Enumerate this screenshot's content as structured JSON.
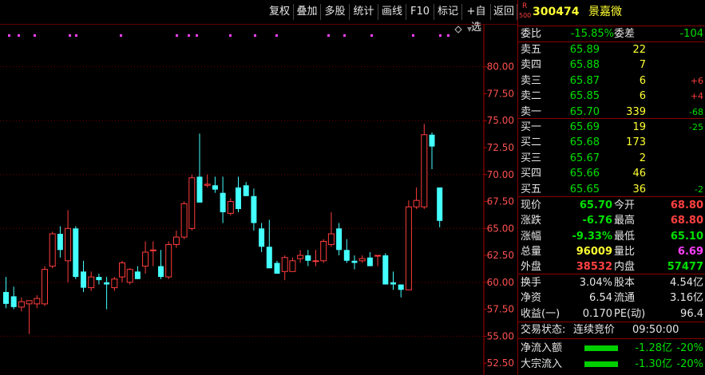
{
  "toolbar": {
    "buttons": [
      "复权",
      "叠加",
      "多股",
      "统计",
      "画线",
      "F10",
      "标记",
      "+自选",
      "返回"
    ]
  },
  "stock": {
    "badge_top": "R",
    "badge_bottom": "500",
    "code": "300474",
    "name": "景嘉微"
  },
  "weibi": {
    "label": "委比",
    "value": "-15.85%",
    "diff_label": "委差",
    "diff_value": "-104"
  },
  "sell": [
    {
      "label": "卖五",
      "price": "65.89",
      "vol": "22",
      "chg": ""
    },
    {
      "label": "卖四",
      "price": "65.88",
      "vol": "7",
      "chg": ""
    },
    {
      "label": "卖三",
      "price": "65.87",
      "vol": "6",
      "chg": "+6"
    },
    {
      "label": "卖二",
      "price": "65.85",
      "vol": "6",
      "chg": "+4"
    },
    {
      "label": "卖一",
      "price": "65.70",
      "vol": "339",
      "chg": "-68"
    }
  ],
  "buy": [
    {
      "label": "买一",
      "price": "65.69",
      "vol": "19",
      "chg": "-25"
    },
    {
      "label": "买二",
      "price": "65.68",
      "vol": "173",
      "chg": ""
    },
    {
      "label": "买三",
      "price": "65.67",
      "vol": "2",
      "chg": ""
    },
    {
      "label": "买四",
      "price": "65.66",
      "vol": "46",
      "chg": ""
    },
    {
      "label": "买五",
      "price": "65.65",
      "vol": "36",
      "chg": "-2"
    }
  ],
  "quote": [
    {
      "l1": "现价",
      "v1": "65.70",
      "c1": "dn",
      "l2": "今开",
      "v2": "68.80",
      "c2": "up"
    },
    {
      "l1": "涨跌",
      "v1": "-6.76",
      "c1": "dn",
      "l2": "最高",
      "v2": "68.80",
      "c2": "up"
    },
    {
      "l1": "涨幅",
      "v1": "-9.33%",
      "c1": "dn",
      "l2": "最低",
      "v2": "65.10",
      "c2": "dn"
    },
    {
      "l1": "总量",
      "v1": "96009",
      "c1": "yl",
      "l2": "量比",
      "v2": "6.69",
      "c2": "mg"
    },
    {
      "l1": "外盘",
      "v1": "38532",
      "c1": "up",
      "l2": "内盘",
      "v2": "57477",
      "c2": "dn"
    }
  ],
  "stats": [
    {
      "l1": "换手",
      "v1": "3.04%",
      "l2": "股本",
      "v2": "4.54亿"
    },
    {
      "l1": "净资",
      "v1": "6.54",
      "l2": "流通",
      "v2": "3.16亿"
    },
    {
      "l1": "收益(一)",
      "v1": "0.170",
      "l2": "PE(动)",
      "v2": "96.4"
    }
  ],
  "status": {
    "label": "交易状态:",
    "value": "连续竞价",
    "time": "09:50:00"
  },
  "flows": [
    {
      "label": "净流入额",
      "value": "-1.28亿",
      "pct": "-20%",
      "fill": 0.42
    },
    {
      "label": "大宗流入",
      "value": "-1.30亿",
      "pct": "-20%",
      "fill": 0.42
    }
  ],
  "chart_data": {
    "type": "candlestick",
    "y_ticks": [
      "80.00",
      "77.50",
      "75.00",
      "72.50",
      "70.00",
      "67.50",
      "65.00",
      "62.50",
      "60.00",
      "57.50",
      "55.00",
      "52.50"
    ],
    "ylim": [
      51.4,
      83.9
    ],
    "colors": {
      "up": "#ff3c3c",
      "down": "#44ffff",
      "grid": "#7a0000",
      "axis": "#b00000"
    },
    "candles": [
      [
        59.1,
        60.5,
        57.6,
        58.0
      ],
      [
        58.7,
        59.6,
        57.5,
        57.7
      ],
      [
        57.7,
        58.6,
        57.3,
        58.2
      ],
      [
        58.0,
        58.3,
        55.2,
        58.3
      ],
      [
        58.0,
        58.8,
        57.6,
        58.5
      ],
      [
        58.0,
        61.5,
        57.8,
        61.2
      ],
      [
        61.5,
        64.7,
        61.3,
        64.5
      ],
      [
        64.5,
        65.2,
        62.3,
        63.0
      ],
      [
        62.0,
        66.7,
        60.0,
        65.0
      ],
      [
        65.0,
        65.2,
        60.3,
        60.5
      ],
      [
        61.0,
        62.0,
        59.1,
        59.5
      ],
      [
        59.5,
        61.0,
        59.2,
        60.5
      ],
      [
        60.5,
        60.8,
        59.8,
        60.2
      ],
      [
        60.0,
        60.5,
        57.5,
        59.8
      ],
      [
        59.5,
        60.5,
        59.2,
        60.3
      ],
      [
        60.5,
        62.0,
        60.0,
        61.8
      ],
      [
        60.0,
        61.3,
        59.8,
        61.2
      ],
      [
        61.0,
        61.5,
        60.3,
        60.3
      ],
      [
        61.5,
        63.8,
        60.8,
        62.8
      ],
      [
        63.0,
        63.8,
        61.5,
        63.0
      ],
      [
        61.5,
        63.0,
        60.3,
        60.5
      ],
      [
        60.5,
        63.8,
        60.3,
        63.5
      ],
      [
        63.5,
        64.8,
        63.2,
        64.2
      ],
      [
        64.2,
        67.5,
        64.0,
        67.3
      ],
      [
        65.0,
        70.0,
        64.8,
        69.7
      ],
      [
        69.8,
        73.8,
        69.8,
        67.4
      ],
      [
        69.0,
        70.0,
        68.8,
        69.1
      ],
      [
        69.0,
        68.3,
        69.8,
        68.6
      ],
      [
        68.3,
        69.8,
        65.5,
        66.5
      ],
      [
        66.4,
        67.8,
        66.2,
        67.5
      ],
      [
        68.8,
        69.8,
        66.5,
        66.8
      ],
      [
        69.0,
        69.3,
        68.0,
        68.0
      ],
      [
        68.0,
        68.7,
        64.8,
        65.5
      ],
      [
        65.0,
        65.5,
        62.8,
        63.3
      ],
      [
        63.3,
        65.8,
        61.5,
        61.3
      ],
      [
        61.8,
        62.0,
        60.8,
        60.8
      ],
      [
        61.0,
        62.5,
        60.2,
        62.3
      ],
      [
        61.0,
        62.3,
        61.0,
        62.0
      ],
      [
        62.2,
        63.0,
        61.8,
        62.5
      ],
      [
        62.5,
        63.0,
        61.5,
        62.0
      ],
      [
        62.0,
        63.0,
        61.5,
        62.0
      ],
      [
        62.0,
        64.0,
        61.8,
        63.8
      ],
      [
        63.5,
        66.5,
        63.3,
        64.5
      ],
      [
        65.0,
        65.5,
        62.5,
        63.0
      ],
      [
        63.0,
        64.0,
        61.8,
        62.0
      ],
      [
        62.0,
        62.5,
        61.2,
        61.8
      ],
      [
        62.0,
        62.5,
        61.8,
        62.2
      ],
      [
        62.3,
        62.8,
        61.5,
        61.5
      ],
      [
        62.5,
        62.5,
        61.5,
        62.5
      ],
      [
        62.5,
        62.7,
        59.8,
        59.8
      ],
      [
        60.0,
        61.0,
        59.3,
        59.8
      ],
      [
        59.8,
        59.8,
        58.6,
        59.3
      ],
      [
        59.3,
        67.6,
        59.3,
        67.0
      ],
      [
        67.0,
        68.8,
        66.8,
        67.6
      ],
      [
        67.0,
        74.7,
        66.8,
        73.7
      ],
      [
        73.7,
        73.9,
        70.5,
        72.6
      ],
      [
        68.8,
        68.8,
        65.1,
        65.7
      ]
    ],
    "markers": [
      10,
      22,
      42,
      86,
      94,
      150,
      220,
      235,
      245,
      287,
      318,
      345,
      410,
      430,
      464,
      516,
      550,
      560
    ]
  }
}
